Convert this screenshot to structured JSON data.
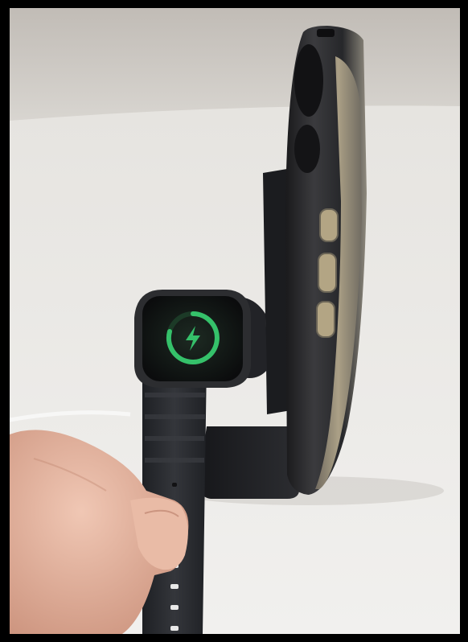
{
  "scene": {
    "kind": "photo",
    "subjects": [
      "phone",
      "smartwatch",
      "charging-stand",
      "hand"
    ],
    "colors": {
      "wall": "#c9c5c0",
      "table": "#ebeae7",
      "stand": "#1d1e20",
      "watch_band": "#2a2c30",
      "charge_ring": "#35c16a",
      "phone_frame": "#b7a77f",
      "skin": "#e2b39f"
    },
    "charging_icon": "lightning-bolt-icon",
    "charge_level": 0.72
  }
}
